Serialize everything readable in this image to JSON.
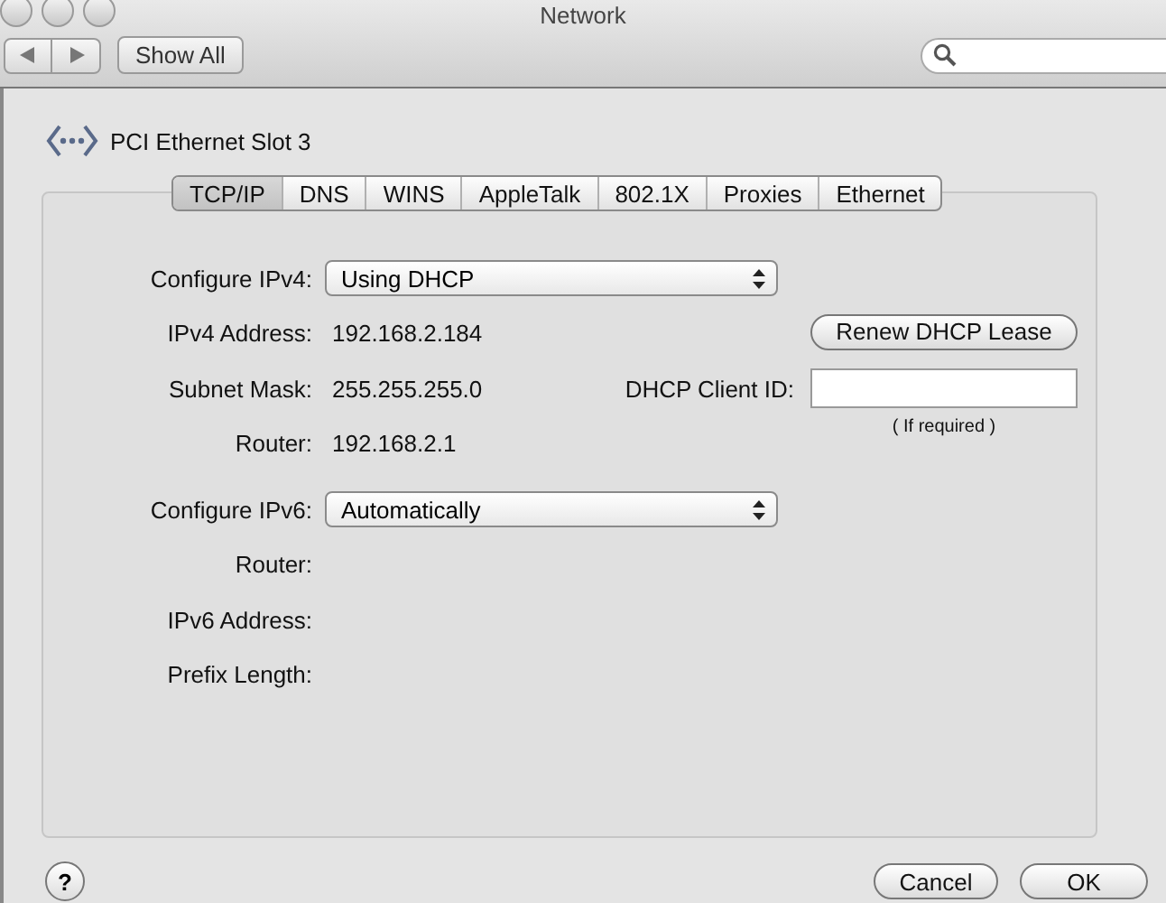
{
  "window": {
    "title": "Network"
  },
  "toolbar": {
    "show_all": "Show All"
  },
  "service": {
    "name": "PCI Ethernet Slot 3"
  },
  "tabs": [
    {
      "label": "TCP/IP",
      "selected": true
    },
    {
      "label": "DNS",
      "selected": false
    },
    {
      "label": "WINS",
      "selected": false
    },
    {
      "label": "AppleTalk",
      "selected": false
    },
    {
      "label": "802.1X",
      "selected": false
    },
    {
      "label": "Proxies",
      "selected": false
    },
    {
      "label": "Ethernet",
      "selected": false
    }
  ],
  "configure_ipv4": {
    "label": "Configure IPv4:",
    "value": "Using DHCP"
  },
  "ipv4_fields": [
    {
      "label": "IPv4 Address:",
      "value": "192.168.2.184"
    },
    {
      "label": "Subnet Mask:",
      "value": "255.255.255.0"
    },
    {
      "label": "Router:",
      "value": "192.168.2.1"
    }
  ],
  "renew_button": "Renew DHCP Lease",
  "client_id": {
    "label": "DHCP Client ID:",
    "hint": "( If required )"
  },
  "configure_ipv6": {
    "label": "Configure IPv6:",
    "value": "Automatically"
  },
  "ipv6_fields": [
    {
      "label": "Router:"
    },
    {
      "label": "IPv6 Address:"
    },
    {
      "label": "Prefix Length:"
    }
  ],
  "help_button": "?",
  "buttons": {
    "cancel": "Cancel",
    "ok": "OK"
  }
}
